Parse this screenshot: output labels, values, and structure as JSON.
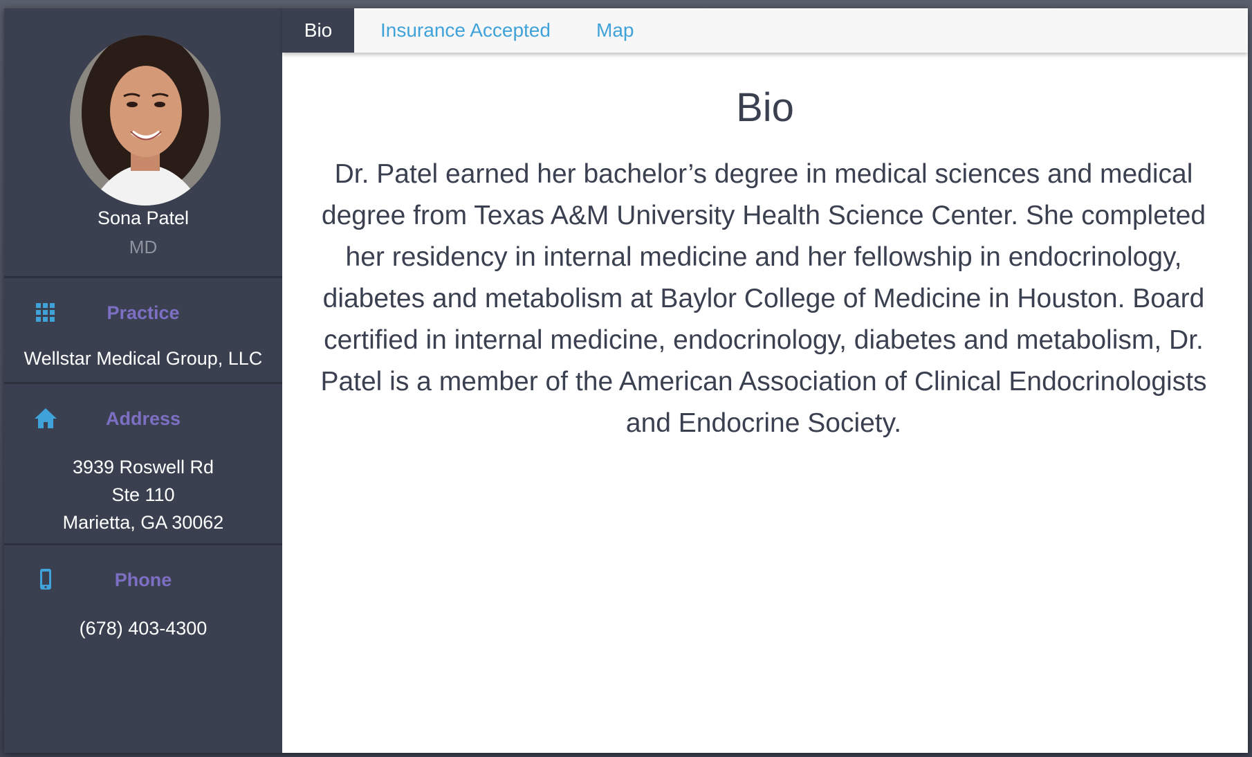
{
  "doctor": {
    "name": "Sona Patel",
    "credential": "MD"
  },
  "sidebar": {
    "practice": {
      "label": "Practice",
      "icon": "grid-icon",
      "value": "Wellstar Medical Group, LLC"
    },
    "address": {
      "label": "Address",
      "icon": "home-icon",
      "line1": "3939 Roswell Rd",
      "line2": "Ste 110",
      "line3": "Marietta, GA 30062"
    },
    "phone": {
      "label": "Phone",
      "icon": "mobile-phone-icon",
      "value": "(678) 403-4300"
    }
  },
  "tabs": [
    {
      "label": "Bio",
      "active": true
    },
    {
      "label": "Insurance Accepted",
      "active": false
    },
    {
      "label": "Map",
      "active": false
    }
  ],
  "bio": {
    "title": "Bio",
    "text": "Dr. Patel earned her bachelor’s degree in medical sciences and medical degree from Texas A&M University Health Science Center. She completed her residency in internal medicine and her fellowship in endocrinology, diabetes and metabolism at Baylor College of Medicine in Houston. Board certified in internal medicine, endocrinology, diabetes and metabolism, Dr. Patel is a member of the American Association of Clinical Endocrinologists and Endocrine Society."
  },
  "colors": {
    "sidebar_bg": "#3a4050",
    "section_heading": "#7d6fc4",
    "icon_blue": "#3fa2d8",
    "tab_link": "#3fa2d8",
    "body_text": "#3a4050"
  }
}
